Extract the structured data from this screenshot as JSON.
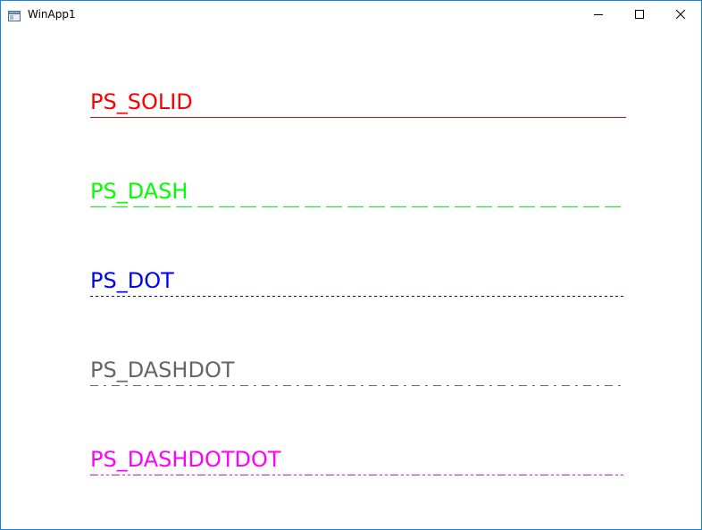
{
  "window": {
    "title": "WinApp1"
  },
  "pens": [
    {
      "label": "PS_SOLID",
      "color": "#ff0000",
      "style": "solid"
    },
    {
      "label": "PS_DASH",
      "color": "#00ff00",
      "style": "dash"
    },
    {
      "label": "PS_DOT",
      "color": "#0000ff",
      "style": "dot"
    },
    {
      "label": "PS_DASHDOT",
      "color": "#666666",
      "style": "dashdot"
    },
    {
      "label": "PS_DASHDOTDOT",
      "color": "#ff00ff",
      "style": "dashdotdot"
    }
  ],
  "icons": {
    "app": "app-window-icon",
    "minimize": "minimize-icon",
    "maximize": "maximize-icon",
    "close": "close-icon"
  }
}
